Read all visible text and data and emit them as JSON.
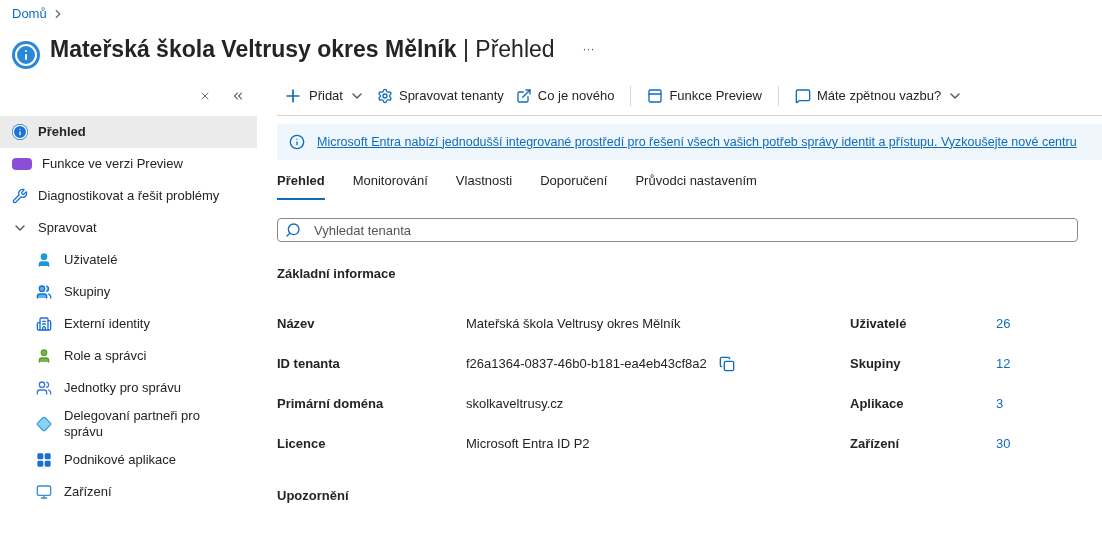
{
  "breadcrumb": [
    "Domů"
  ],
  "title": {
    "name": "Mateřská škola Veltrusy okres Mělník",
    "separator": "|",
    "section": "Přehled",
    "more": "···"
  },
  "sidebar": {
    "items": [
      {
        "label": "Přehled",
        "selected": true
      },
      {
        "label": "Funkce ve verzi Preview",
        "selected": false
      },
      {
        "label": "Diagnostikovat a řešit problémy",
        "selected": false
      },
      {
        "label": "Spravovat",
        "selected": false,
        "expanded": true,
        "children": [
          {
            "label": "Uživatelé",
            "selected": false
          },
          {
            "label": "Skupiny",
            "selected": false
          },
          {
            "label": "Externí identity",
            "selected": false
          },
          {
            "label": "Role a správci",
            "selected": false
          },
          {
            "label": "Jednotky pro správu",
            "selected": false
          },
          {
            "label": "Delegovaní partneři pro správu",
            "selected": false
          },
          {
            "label": "Podnikové aplikace",
            "selected": false
          },
          {
            "label": "Zařízení",
            "selected": false
          }
        ]
      }
    ]
  },
  "toolbar": [
    {
      "label": "Přidat",
      "dropdown": true
    },
    {
      "label": "Spravovat tenanty",
      "dropdown": false
    },
    {
      "label": "Co je nového",
      "dropdown": false
    },
    {
      "label": "Funkce Preview",
      "dropdown": false
    },
    {
      "label": "Máte zpětnou vazbu?",
      "dropdown": true
    }
  ],
  "banner": "Microsoft Entra nabízí jednodušší integrované prostředí pro řešení všech vašich potřeb správy identit a přístupu. Vyzkoušejte nové centru",
  "tabs": [
    {
      "label": "Přehled",
      "selected": true
    },
    {
      "label": "Monitorování",
      "selected": false
    },
    {
      "label": "Vlastnosti",
      "selected": false
    },
    {
      "label": "Doporučení",
      "selected": false
    },
    {
      "label": "Průvodci nastavením",
      "selected": false
    }
  ],
  "search": {
    "placeholder": "Vyhledat tenanta"
  },
  "basic_info": {
    "heading": "Základní informace",
    "rows": [
      {
        "label": "Název",
        "value": "Mateřská škola Veltrusy okres Mělník",
        "copy": false,
        "stat_label": "Uživatelé",
        "stat_value": "26"
      },
      {
        "label": "ID tenanta",
        "value": "f26a1364-0837-46b0-b181-ea4eb43cf8a2",
        "copy": true,
        "stat_label": "Skupiny",
        "stat_value": "12"
      },
      {
        "label": "Primární doména",
        "value": "skolkaveltrusy.cz",
        "copy": false,
        "stat_label": "Aplikace",
        "stat_value": "3"
      },
      {
        "label": "Licence",
        "value": "Microsoft Entra ID P2",
        "copy": false,
        "stat_label": "Zařízení",
        "stat_value": "30"
      }
    ]
  },
  "alerts_heading": "Upozornění"
}
